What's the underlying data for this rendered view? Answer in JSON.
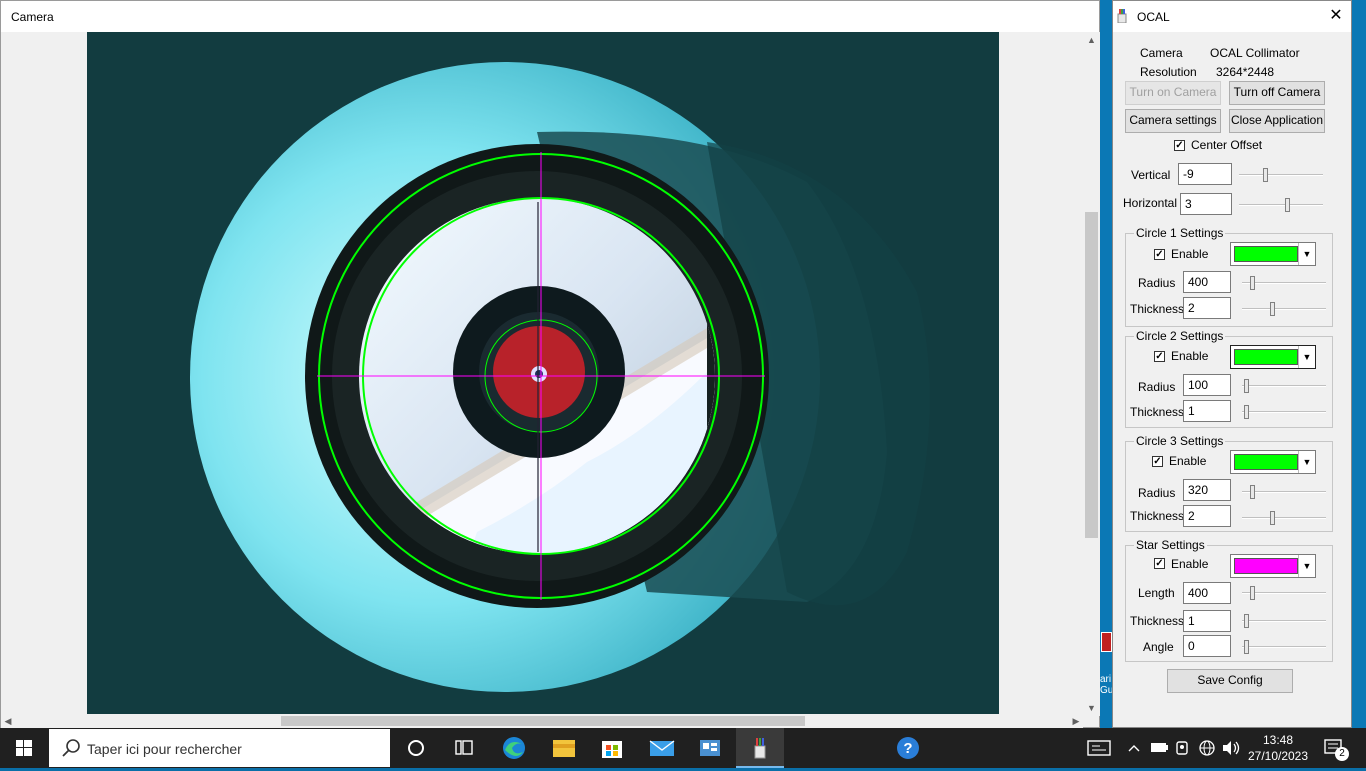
{
  "camera_window": {
    "title": "Camera"
  },
  "ocal": {
    "title": "OCAL",
    "camera_label": "Camera",
    "camera_value": "OCAL Collimator",
    "resolution_label": "Resolution",
    "resolution_value": "3264*2448",
    "buttons": {
      "turn_on": "Turn on Camera",
      "turn_off": "Turn off Camera",
      "settings": "Camera settings",
      "close_app": "Close Application",
      "save": "Save Config"
    },
    "center_offset": {
      "label": "Center Offset",
      "checked": true
    },
    "vertical": {
      "label": "Vertical",
      "value": "-9"
    },
    "horizontal": {
      "label": "Horizontal",
      "value": "3"
    },
    "circle1": {
      "title": "Circle 1 Settings",
      "enable_label": "Enable",
      "color": "#00ff00",
      "radius_label": "Radius",
      "radius": "400",
      "thickness_label": "Thickness",
      "thickness": "2"
    },
    "circle2": {
      "title": "Circle 2 Settings",
      "enable_label": "Enable",
      "color": "#00ff00",
      "radius_label": "Radius",
      "radius": "100",
      "thickness_label": "Thickness",
      "thickness": "1"
    },
    "circle3": {
      "title": "Circle 3 Settings",
      "enable_label": "Enable",
      "color": "#00ff00",
      "radius_label": "Radius",
      "radius": "320",
      "thickness_label": "Thickness",
      "thickness": "2"
    },
    "star": {
      "title": "Star Settings",
      "enable_label": "Enable",
      "color": "#ff00ff",
      "length_label": "Length",
      "length": "400",
      "thickness_label": "Thickness",
      "thickness": "1",
      "angle_label": "Angle",
      "angle": "0"
    }
  },
  "taskbar": {
    "search_placeholder": "Taper ici pour rechercher",
    "time": "13:48",
    "date": "27/10/2023",
    "notification_count": "2",
    "icons": [
      "windows-start-icon",
      "search-icon",
      "cortana-icon",
      "task-view-icon",
      "edge-icon",
      "file-explorer-icon",
      "store-icon",
      "mail-icon",
      "app-icon",
      "ocal-icon",
      "help-icon"
    ]
  },
  "desktop": {
    "label_fragment": "ari Gu"
  }
}
